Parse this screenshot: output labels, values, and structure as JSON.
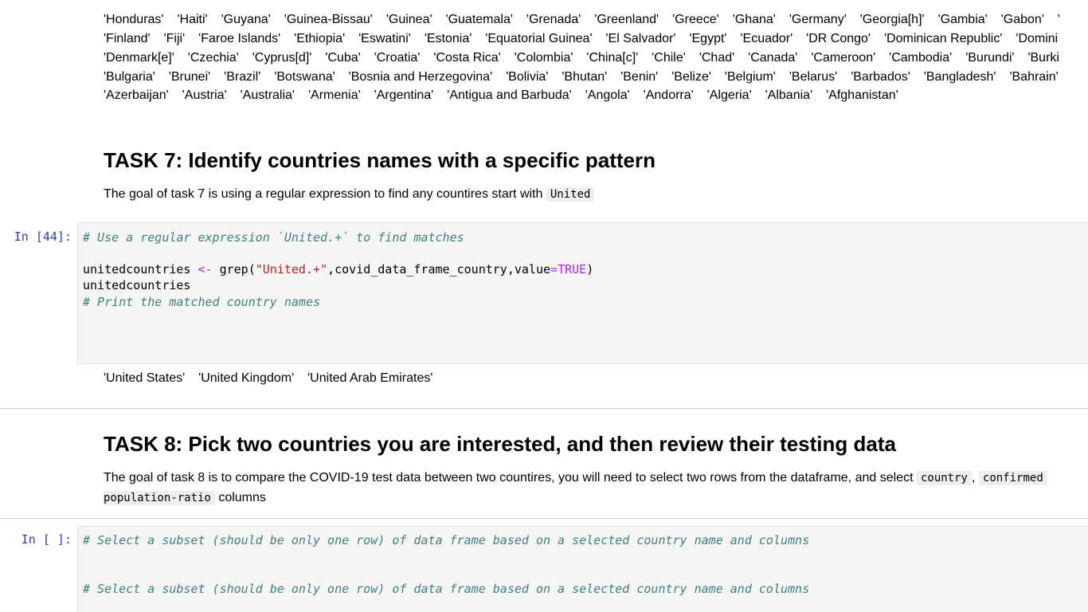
{
  "output_rows": [
    [
      "'Honduras'",
      "'Haiti'",
      "'Guyana'",
      "'Guinea-Bissau'",
      "'Guinea'",
      "'Guatemala'",
      "'Grenada'",
      "'Greenland'",
      "'Greece'",
      "'Ghana'",
      "'Germany'",
      "'Georgia[h]'",
      "'Gambia'",
      "'Gabon'",
      "'"
    ],
    [
      "'Finland'",
      "'Fiji'",
      "'Faroe Islands'",
      "'Ethiopia'",
      "'Eswatini'",
      "'Estonia'",
      "'Equatorial Guinea'",
      "'El Salvador'",
      "'Egypt'",
      "'Ecuador'",
      "'DR Congo'",
      "'Dominican Republic'",
      "'Domini"
    ],
    [
      "'Denmark[e]'",
      "'Czechia'",
      "'Cyprus[d]'",
      "'Cuba'",
      "'Croatia'",
      "'Costa Rica'",
      "'Colombia'",
      "'China[c]'",
      "'Chile'",
      "'Chad'",
      "'Canada'",
      "'Cameroon'",
      "'Cambodia'",
      "'Burundi'",
      "'Burki"
    ],
    [
      "'Bulgaria'",
      "'Brunei'",
      "'Brazil'",
      "'Botswana'",
      "'Bosnia and Herzegovina'",
      "'Bolivia'",
      "'Bhutan'",
      "'Benin'",
      "'Belize'",
      "'Belgium'",
      "'Belarus'",
      "'Barbados'",
      "'Bangladesh'",
      "'Bahrain'"
    ],
    [
      "'Azerbaijan'",
      "'Austria'",
      "'Australia'",
      "'Armenia'",
      "'Argentina'",
      "'Antigua and Barbuda'",
      "'Angola'",
      "'Andorra'",
      "'Algeria'",
      "'Albania'",
      "'Afghanistan'"
    ]
  ],
  "task7": {
    "heading": "TASK 7: Identify countries names with a specific pattern",
    "description": "The goal of task 7 is using a regular expression to find any countires start with",
    "description_code": "United"
  },
  "cell44": {
    "prompt": "In [44]:",
    "comment1": "# Use a regular expression `United.+` to find matches",
    "line2_var": "unitedcountries",
    "line2_assign": "<-",
    "line2_fn": "grep(",
    "line2_str": "\"United.+\"",
    "line2_args": ",covid_data_frame_country,value",
    "line2_eq": "=",
    "line2_true": "TRUE",
    "line2_close": ")",
    "line3": "unitedcountries",
    "comment2": "# Print the matched country names",
    "output": [
      "'United States'",
      "'United Kingdom'",
      "'United Arab Emirates'"
    ]
  },
  "task8": {
    "heading": "TASK 8: Pick two countries you are interested, and then review their testing data",
    "description": "The goal of task 8 is to compare the COVID-19 test data between two countires, you will need to select two rows from the dataframe, and select",
    "code1": "country",
    "comma": ",",
    "code2": "confirmed",
    "code3": "population-ratio",
    "tail": "columns"
  },
  "cell_empty": {
    "prompt": "In [ ]:",
    "comment1": "# Select a subset (should be only one row) of data frame based on a selected country name and columns",
    "comment2": "# Select a subset (should be only one row) of data frame based on a selected country name and columns"
  }
}
